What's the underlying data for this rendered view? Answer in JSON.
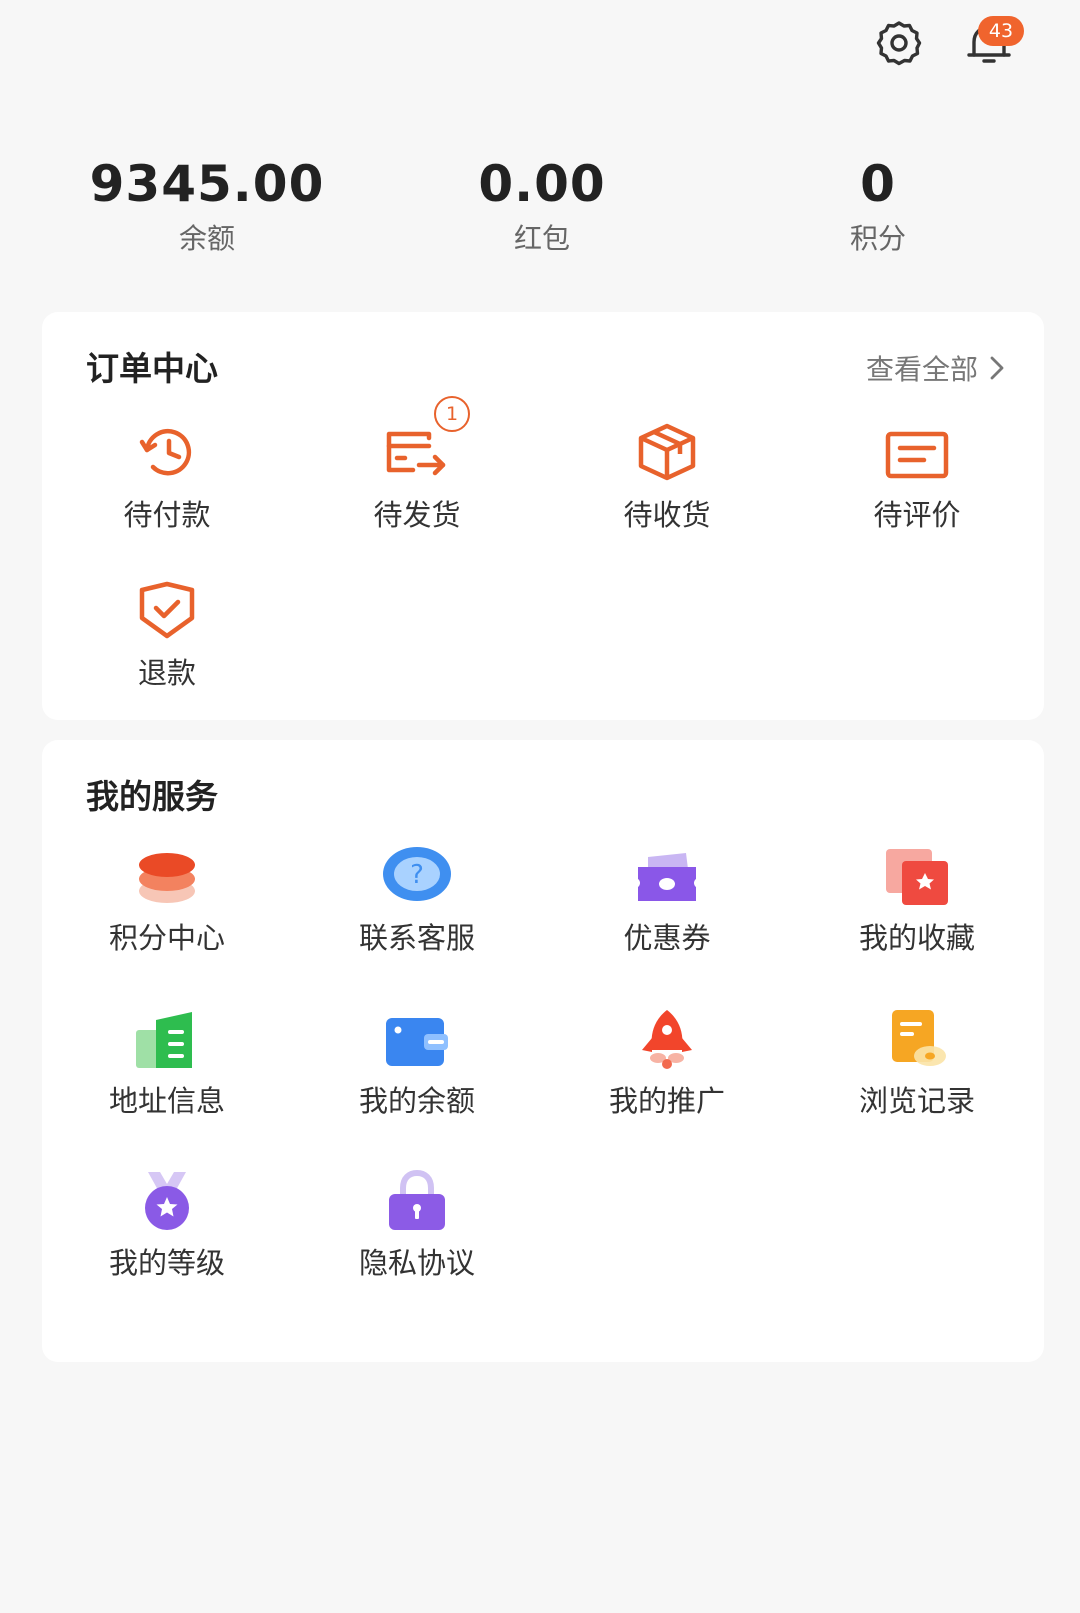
{
  "header": {
    "notification_count": "43",
    "settings_icon": "gear-icon",
    "notification_icon": "bell-icon"
  },
  "stats": [
    {
      "value": "9345.00",
      "label": "余额"
    },
    {
      "value": "0.00",
      "label": "红包"
    },
    {
      "value": "0",
      "label": "积分"
    }
  ],
  "orders": {
    "title": "订单中心",
    "view_all": "查看全部",
    "items": [
      {
        "label": "待付款",
        "icon": "clock-history-icon"
      },
      {
        "label": "待发货",
        "icon": "card-send-icon",
        "badge": "1"
      },
      {
        "label": "待收货",
        "icon": "package-box-icon"
      },
      {
        "label": "待评价",
        "icon": "comment-lines-icon"
      },
      {
        "label": "退款",
        "icon": "shield-check-icon"
      }
    ]
  },
  "services": {
    "title": "我的服务",
    "items": [
      {
        "label": "积分中心",
        "icon": "coin-stack-icon"
      },
      {
        "label": "联系客服",
        "icon": "help-bubble-icon"
      },
      {
        "label": "优惠券",
        "icon": "coupon-ticket-icon"
      },
      {
        "label": "我的收藏",
        "icon": "star-card-icon"
      },
      {
        "label": "地址信息",
        "icon": "building-icon"
      },
      {
        "label": "我的余额",
        "icon": "wallet-icon"
      },
      {
        "label": "我的推广",
        "icon": "rocket-icon"
      },
      {
        "label": "浏览记录",
        "icon": "history-doc-icon"
      },
      {
        "label": "我的等级",
        "icon": "medal-icon"
      },
      {
        "label": "隐私协议",
        "icon": "padlock-icon"
      }
    ]
  },
  "colors": {
    "accent": "#e8622c",
    "badge": "#f0642d",
    "background": "#f7f7f7"
  }
}
